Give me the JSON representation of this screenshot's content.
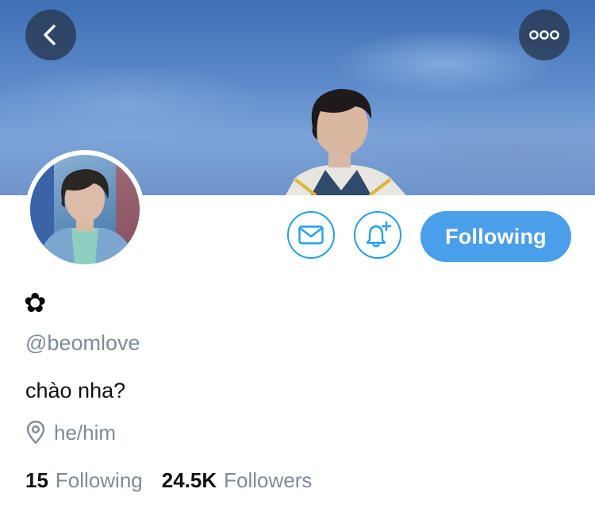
{
  "header": {
    "back_icon": "chevron-left-icon",
    "more_icon": "ellipsis-icon"
  },
  "actions": {
    "message_icon": "envelope-icon",
    "notify_icon": "bell-plus-icon",
    "follow_label": "Following"
  },
  "profile": {
    "display_name": "✿",
    "handle": "@beomlove",
    "bio": "chào nha?",
    "location": "he/him",
    "location_icon": "map-pin-icon"
  },
  "stats": {
    "following_count": "15",
    "following_label": "Following",
    "followers_count": "24.5K",
    "followers_label": "Followers"
  },
  "colors": {
    "accent": "#1da1f2",
    "button_fill": "#4a9fea",
    "secondary_text": "#7d8b98"
  }
}
